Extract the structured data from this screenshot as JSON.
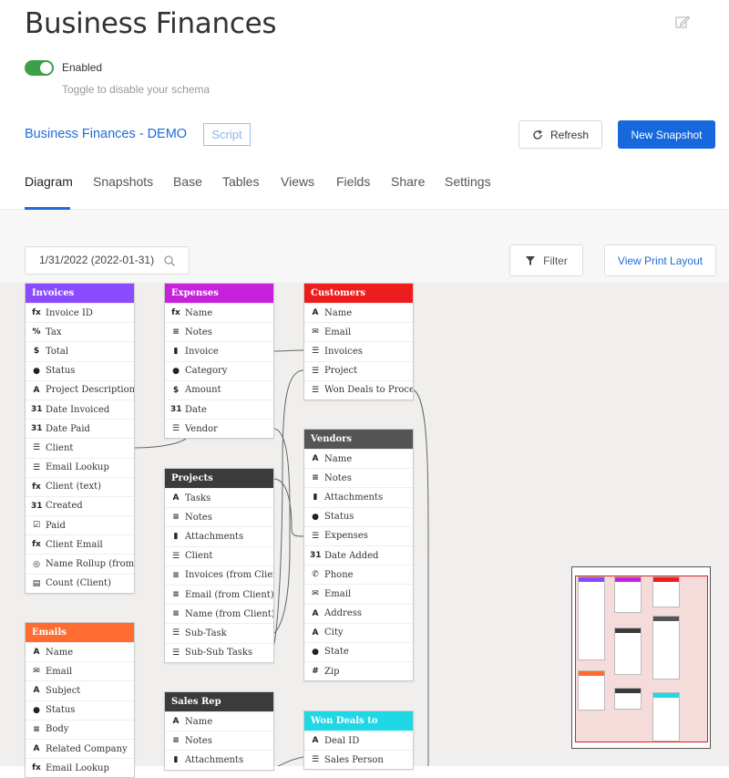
{
  "header": {
    "title": "Business Finances",
    "edit_icon": "pencil-square-icon"
  },
  "schema_toggle": {
    "label": "Enabled",
    "hint": "Toggle to disable your schema",
    "on": true,
    "color": "#3aa04a"
  },
  "base": {
    "name": "Business Finances - DEMO",
    "badge": "Script"
  },
  "actions": {
    "refresh": "Refresh",
    "new_snapshot": "New Snapshot"
  },
  "tabs": [
    "Diagram",
    "Snapshots",
    "Base",
    "Tables",
    "Views",
    "Fields",
    "Share",
    "Settings"
  ],
  "active_tab": "Diagram",
  "toolbar": {
    "date": "1/31/2022 (2022-01-31)",
    "filter": "Filter",
    "print": "View Print Layout"
  },
  "tables": [
    {
      "name": "Invoices",
      "color": "#8a4bff",
      "fields": [
        [
          "fx",
          "Invoice ID"
        ],
        [
          "%",
          "Tax"
        ],
        [
          "$",
          "Total"
        ],
        [
          "●",
          "Status"
        ],
        [
          "A",
          "Project Description"
        ],
        [
          "31",
          "Date Invoiced"
        ],
        [
          "31",
          "Date Paid"
        ],
        [
          "☰",
          "Client"
        ],
        [
          "☰",
          "Email Lookup"
        ],
        [
          "fx",
          "Client (text)"
        ],
        [
          "31",
          "Created"
        ],
        [
          "☑",
          "Paid"
        ],
        [
          "fx",
          "Client Email"
        ],
        [
          "◎",
          "Name Rollup (from Cl..."
        ],
        [
          "▤",
          "Count (Client)"
        ]
      ]
    },
    {
      "name": "Emails",
      "color": "#ff6c2f",
      "fields": [
        [
          "A",
          "Name"
        ],
        [
          "✉",
          "Email"
        ],
        [
          "A",
          "Subject"
        ],
        [
          "●",
          "Status"
        ],
        [
          "≡",
          "Body"
        ],
        [
          "A",
          "Related Company"
        ],
        [
          "fx",
          "Email Lookup"
        ]
      ]
    },
    {
      "name": "Expenses",
      "color": "#c622dc",
      "fields": [
        [
          "fx",
          "Name"
        ],
        [
          "≡",
          "Notes"
        ],
        [
          "▮",
          "Invoice"
        ],
        [
          "●",
          "Category"
        ],
        [
          "$",
          "Amount"
        ],
        [
          "31",
          "Date"
        ],
        [
          "☰",
          "Vendor"
        ]
      ]
    },
    {
      "name": "Projects",
      "color": "#3b3b3b",
      "fields": [
        [
          "A",
          "Tasks"
        ],
        [
          "≡",
          "Notes"
        ],
        [
          "▮",
          "Attachments"
        ],
        [
          "☰",
          "Client"
        ],
        [
          "≡",
          "Invoices (from Client)"
        ],
        [
          "≡",
          "Email (from Client)"
        ],
        [
          "≡",
          "Name (from Client)"
        ],
        [
          "☰",
          "Sub-Task"
        ],
        [
          "☰",
          "Sub-Sub Tasks"
        ]
      ]
    },
    {
      "name": "Sales Rep",
      "color": "#3b3b3b",
      "fields": [
        [
          "A",
          "Name"
        ],
        [
          "≡",
          "Notes"
        ],
        [
          "▮",
          "Attachments"
        ]
      ]
    },
    {
      "name": "Customers",
      "color": "#ee1d1d",
      "fields": [
        [
          "A",
          "Name"
        ],
        [
          "✉",
          "Email"
        ],
        [
          "☰",
          "Invoices"
        ],
        [
          "☰",
          "Project"
        ],
        [
          "☰",
          "Won Deals to Process"
        ]
      ]
    },
    {
      "name": "Vendors",
      "color": "#555555",
      "fields": [
        [
          "A",
          "Name"
        ],
        [
          "≡",
          "Notes"
        ],
        [
          "▮",
          "Attachments"
        ],
        [
          "●",
          "Status"
        ],
        [
          "☰",
          "Expenses"
        ],
        [
          "31",
          "Date Added"
        ],
        [
          "✆",
          "Phone"
        ],
        [
          "✉",
          "Email"
        ],
        [
          "A",
          "Address"
        ],
        [
          "A",
          "City"
        ],
        [
          "●",
          "State"
        ],
        [
          "#",
          "Zip"
        ]
      ]
    },
    {
      "name": "Won Deals to Process",
      "color": "#1fd8e5",
      "fields": [
        [
          "A",
          "Deal ID"
        ],
        [
          "☰",
          "Sales Person"
        ]
      ]
    }
  ]
}
